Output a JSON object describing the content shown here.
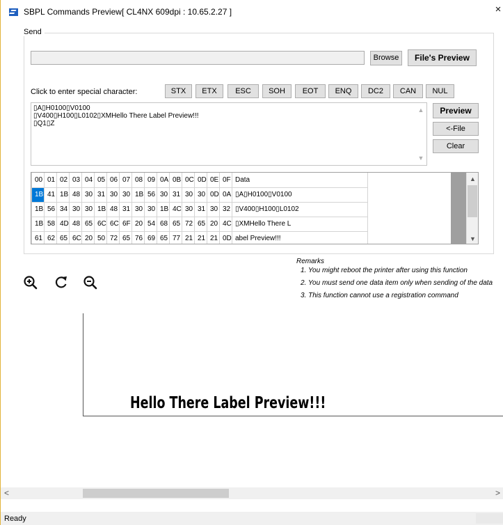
{
  "window": {
    "title": "SBPL Commands Preview[ CL4NX 609dpi : 10.65.2.27 ]",
    "close_glyph": "×"
  },
  "send": {
    "group_label": "Send",
    "file_path": "",
    "browse_label": "Browse",
    "files_preview_label": "File's Preview",
    "special_label": "Click to enter special character:",
    "special_chars": [
      "STX",
      "ETX",
      "ESC",
      "SOH",
      "EOT",
      "ENQ",
      "DC2",
      "CAN",
      "NUL"
    ],
    "command_lines": [
      "\u001bA\u001bH0100\u001bV0100",
      "\u001bV400\u001bH100\u001bL0102\u001bXMHello There Label Preview!!!",
      "\u001bQ1\u001bZ"
    ],
    "command_display": [
      "▯A▯H0100▯V0100",
      "▯V400▯H100▯L0102▯XMHello There Label Preview!!!",
      "▯Q1▯Z"
    ],
    "preview_label": "Preview",
    "file_back_label": "<-File",
    "clear_label": "Clear"
  },
  "hex_grid": {
    "headers": [
      "00",
      "01",
      "02",
      "03",
      "04",
      "05",
      "06",
      "07",
      "08",
      "09",
      "0A",
      "0B",
      "0C",
      "0D",
      "0E",
      "0F",
      "Data"
    ],
    "rows": [
      [
        "1B",
        "41",
        "1B",
        "48",
        "30",
        "31",
        "30",
        "30",
        "1B",
        "56",
        "30",
        "31",
        "30",
        "30",
        "0D",
        "0A",
        "▯A▯H0100▯V0100"
      ],
      [
        "1B",
        "56",
        "34",
        "30",
        "30",
        "1B",
        "48",
        "31",
        "30",
        "30",
        "1B",
        "4C",
        "30",
        "31",
        "30",
        "32",
        "▯V400▯H100▯L0102"
      ],
      [
        "1B",
        "58",
        "4D",
        "48",
        "65",
        "6C",
        "6C",
        "6F",
        "20",
        "54",
        "68",
        "65",
        "72",
        "65",
        "20",
        "4C",
        "▯XMHello There L"
      ],
      [
        "61",
        "62",
        "65",
        "6C",
        "20",
        "50",
        "72",
        "65",
        "76",
        "69",
        "65",
        "77",
        "21",
        "21",
        "21",
        "0D",
        "abel Preview!!!"
      ]
    ],
    "selected_cell": "1B"
  },
  "preview": {
    "zoom_in_icon": "zoom-in-icon",
    "rotate_icon": "rotate-icon",
    "zoom_out_icon": "zoom-out-icon",
    "label_text": "Hello There Label Preview!!!"
  },
  "remarks": {
    "title": "Remarks",
    "items": [
      "1. You might reboot the printer after using this function",
      "2. You must send one data item only when sending of the data",
      "3. This function cannot use a registration command"
    ]
  },
  "scrollbar": {
    "left_arrow": "<",
    "right_arrow": ">"
  },
  "status": {
    "text": "Ready"
  },
  "colors": {
    "accent": "#0078d7",
    "window_border": "#e2b33a",
    "icon_blue": "#1f5fbf"
  }
}
